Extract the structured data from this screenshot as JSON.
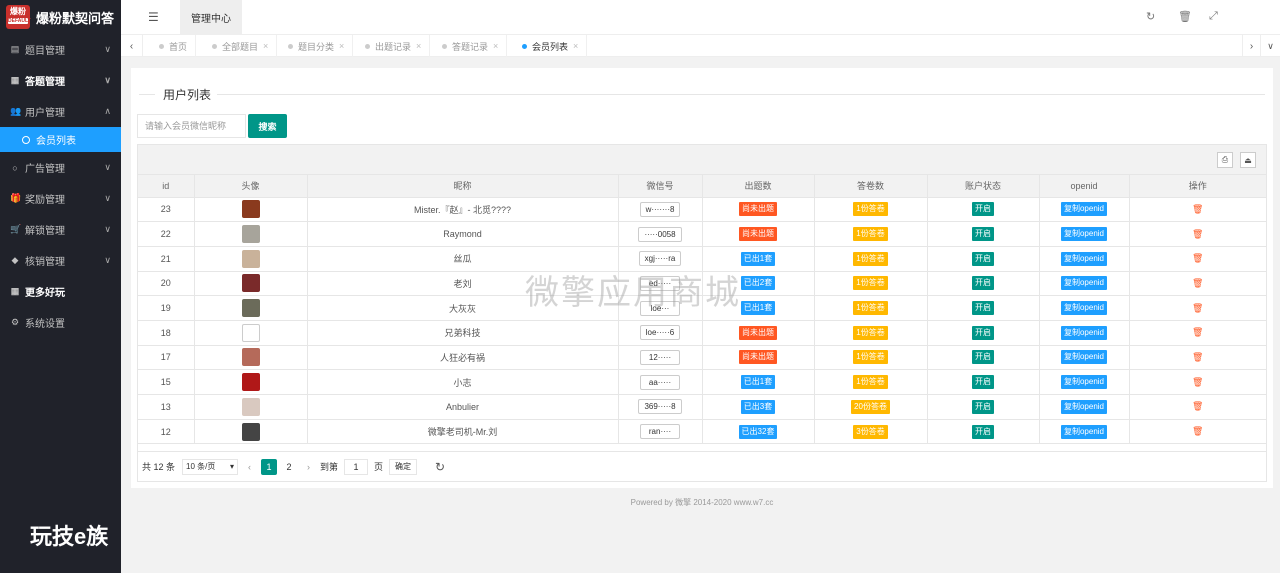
{
  "app": {
    "logo_badge": "爆粉",
    "logo_badge_sub": "DEFAULT",
    "title": "爆粉默契问答"
  },
  "sidebar": {
    "items": [
      {
        "label": "题目管理",
        "icon": "book-icon",
        "arrow": "∨",
        "bold": false
      },
      {
        "label": "答题管理",
        "icon": "calendar-icon",
        "arrow": "∨",
        "bold": true
      },
      {
        "label": "用户管理",
        "icon": "users-icon",
        "arrow": "∧",
        "bold": false
      },
      {
        "label": "广告管理",
        "icon": "circle-icon",
        "arrow": "∨",
        "bold": false
      },
      {
        "label": "奖励管理",
        "icon": "gift-icon",
        "arrow": "∨",
        "bold": false
      },
      {
        "label": "解锁管理",
        "icon": "cart-icon",
        "arrow": "∨",
        "bold": false
      },
      {
        "label": "核销管理",
        "icon": "tag-icon",
        "arrow": "∨",
        "bold": false
      },
      {
        "label": "更多好玩",
        "icon": "grid-icon",
        "arrow": "",
        "bold": true
      },
      {
        "label": "系统设置",
        "icon": "gear-icon",
        "arrow": "",
        "bold": false
      }
    ],
    "active_sub": "会员列表",
    "bottom_text": "玩技e族"
  },
  "topbar": {
    "main_tab": "管理中心"
  },
  "tabs": [
    {
      "label": "首页",
      "closable": false,
      "active": false
    },
    {
      "label": "全部题目",
      "closable": true,
      "active": false
    },
    {
      "label": "题目分类",
      "closable": true,
      "active": false
    },
    {
      "label": "出题记录",
      "closable": true,
      "active": false
    },
    {
      "label": "答题记录",
      "closable": true,
      "active": false
    },
    {
      "label": "会员列表",
      "closable": true,
      "active": true
    }
  ],
  "panel": {
    "legend": "用户列表",
    "search_placeholder": "请输入会员微信昵称",
    "search_button": "搜索"
  },
  "table": {
    "columns": [
      "id",
      "头像",
      "昵称",
      "微信号",
      "出题数",
      "答卷数",
      "账户状态",
      "openid",
      "操作"
    ],
    "rows": [
      {
        "id": "23",
        "avatar_color": "#8a3a1e",
        "nickname": "Mister.『赵』- 北觅????",
        "wechat": "w·······8",
        "q": "尚未出题",
        "q_color": "red",
        "a": "1份答卷",
        "status": "开启",
        "openid": "复制openid"
      },
      {
        "id": "22",
        "avatar_color": "#a7a49b",
        "nickname": "Raymond",
        "wechat": "·····0058",
        "q": "尚未出题",
        "q_color": "red",
        "a": "1份答卷",
        "status": "开启",
        "openid": "复制openid"
      },
      {
        "id": "21",
        "avatar_color": "#c9b29a",
        "nickname": "丝瓜",
        "wechat": "xgj·····ra",
        "q": "已出1套",
        "q_color": "blue",
        "a": "1份答卷",
        "status": "开启",
        "openid": "复制openid"
      },
      {
        "id": "20",
        "avatar_color": "#7a2a2a",
        "nickname": "老刘",
        "wechat": "ed·····",
        "q": "已出2套",
        "q_color": "blue",
        "a": "1份答卷",
        "status": "开启",
        "openid": "复制openid"
      },
      {
        "id": "19",
        "avatar_color": "#6b6b5a",
        "nickname": "大灰灰",
        "wechat": "loe···",
        "q": "已出1套",
        "q_color": "blue",
        "a": "1份答卷",
        "status": "开启",
        "openid": "复制openid"
      },
      {
        "id": "18",
        "avatar_color": "#ffffff",
        "nickname": "兄弟科技",
        "wechat": "loe·····6",
        "q": "尚未出题",
        "q_color": "red",
        "a": "1份答卷",
        "status": "开启",
        "openid": "复制openid"
      },
      {
        "id": "17",
        "avatar_color": "#b56a5a",
        "nickname": "人狂必有祸",
        "wechat": "12·····",
        "q": "尚未出题",
        "q_color": "red",
        "a": "1份答卷",
        "status": "开启",
        "openid": "复制openid"
      },
      {
        "id": "15",
        "avatar_color": "#b01818",
        "nickname": "小志",
        "wechat": "aa·····",
        "q": "已出1套",
        "q_color": "blue",
        "a": "1份答卷",
        "status": "开启",
        "openid": "复制openid"
      },
      {
        "id": "13",
        "avatar_color": "#d9c9c0",
        "nickname": "Anbulier",
        "wechat": "369·····8",
        "q": "已出3套",
        "q_color": "blue",
        "a": "20份答卷",
        "status": "开启",
        "openid": "复制openid"
      },
      {
        "id": "12",
        "avatar_color": "#444444",
        "nickname": "微擎老司机-Mr.刘",
        "wechat": "ran····",
        "q": "已出32套",
        "q_color": "blue",
        "a": "3份答卷",
        "status": "开启",
        "openid": "复制openid"
      }
    ]
  },
  "pager": {
    "total": "共 12 条",
    "per_page": "10 条/页",
    "prev": "‹",
    "current": "1",
    "next_page": "2",
    "next": "›",
    "goto_label": "到第",
    "goto_value": "1",
    "page_unit": "页",
    "ok": "确定"
  },
  "footer": "Powered by 微擎 2014-2020 www.w7.cc",
  "watermark": "微擎应用商城",
  "colors": {
    "sidebar_bg": "#20222a",
    "active_blue": "#1e9fff",
    "primary_green": "#009688",
    "danger": "#ff5722",
    "warning": "#ffb800"
  }
}
